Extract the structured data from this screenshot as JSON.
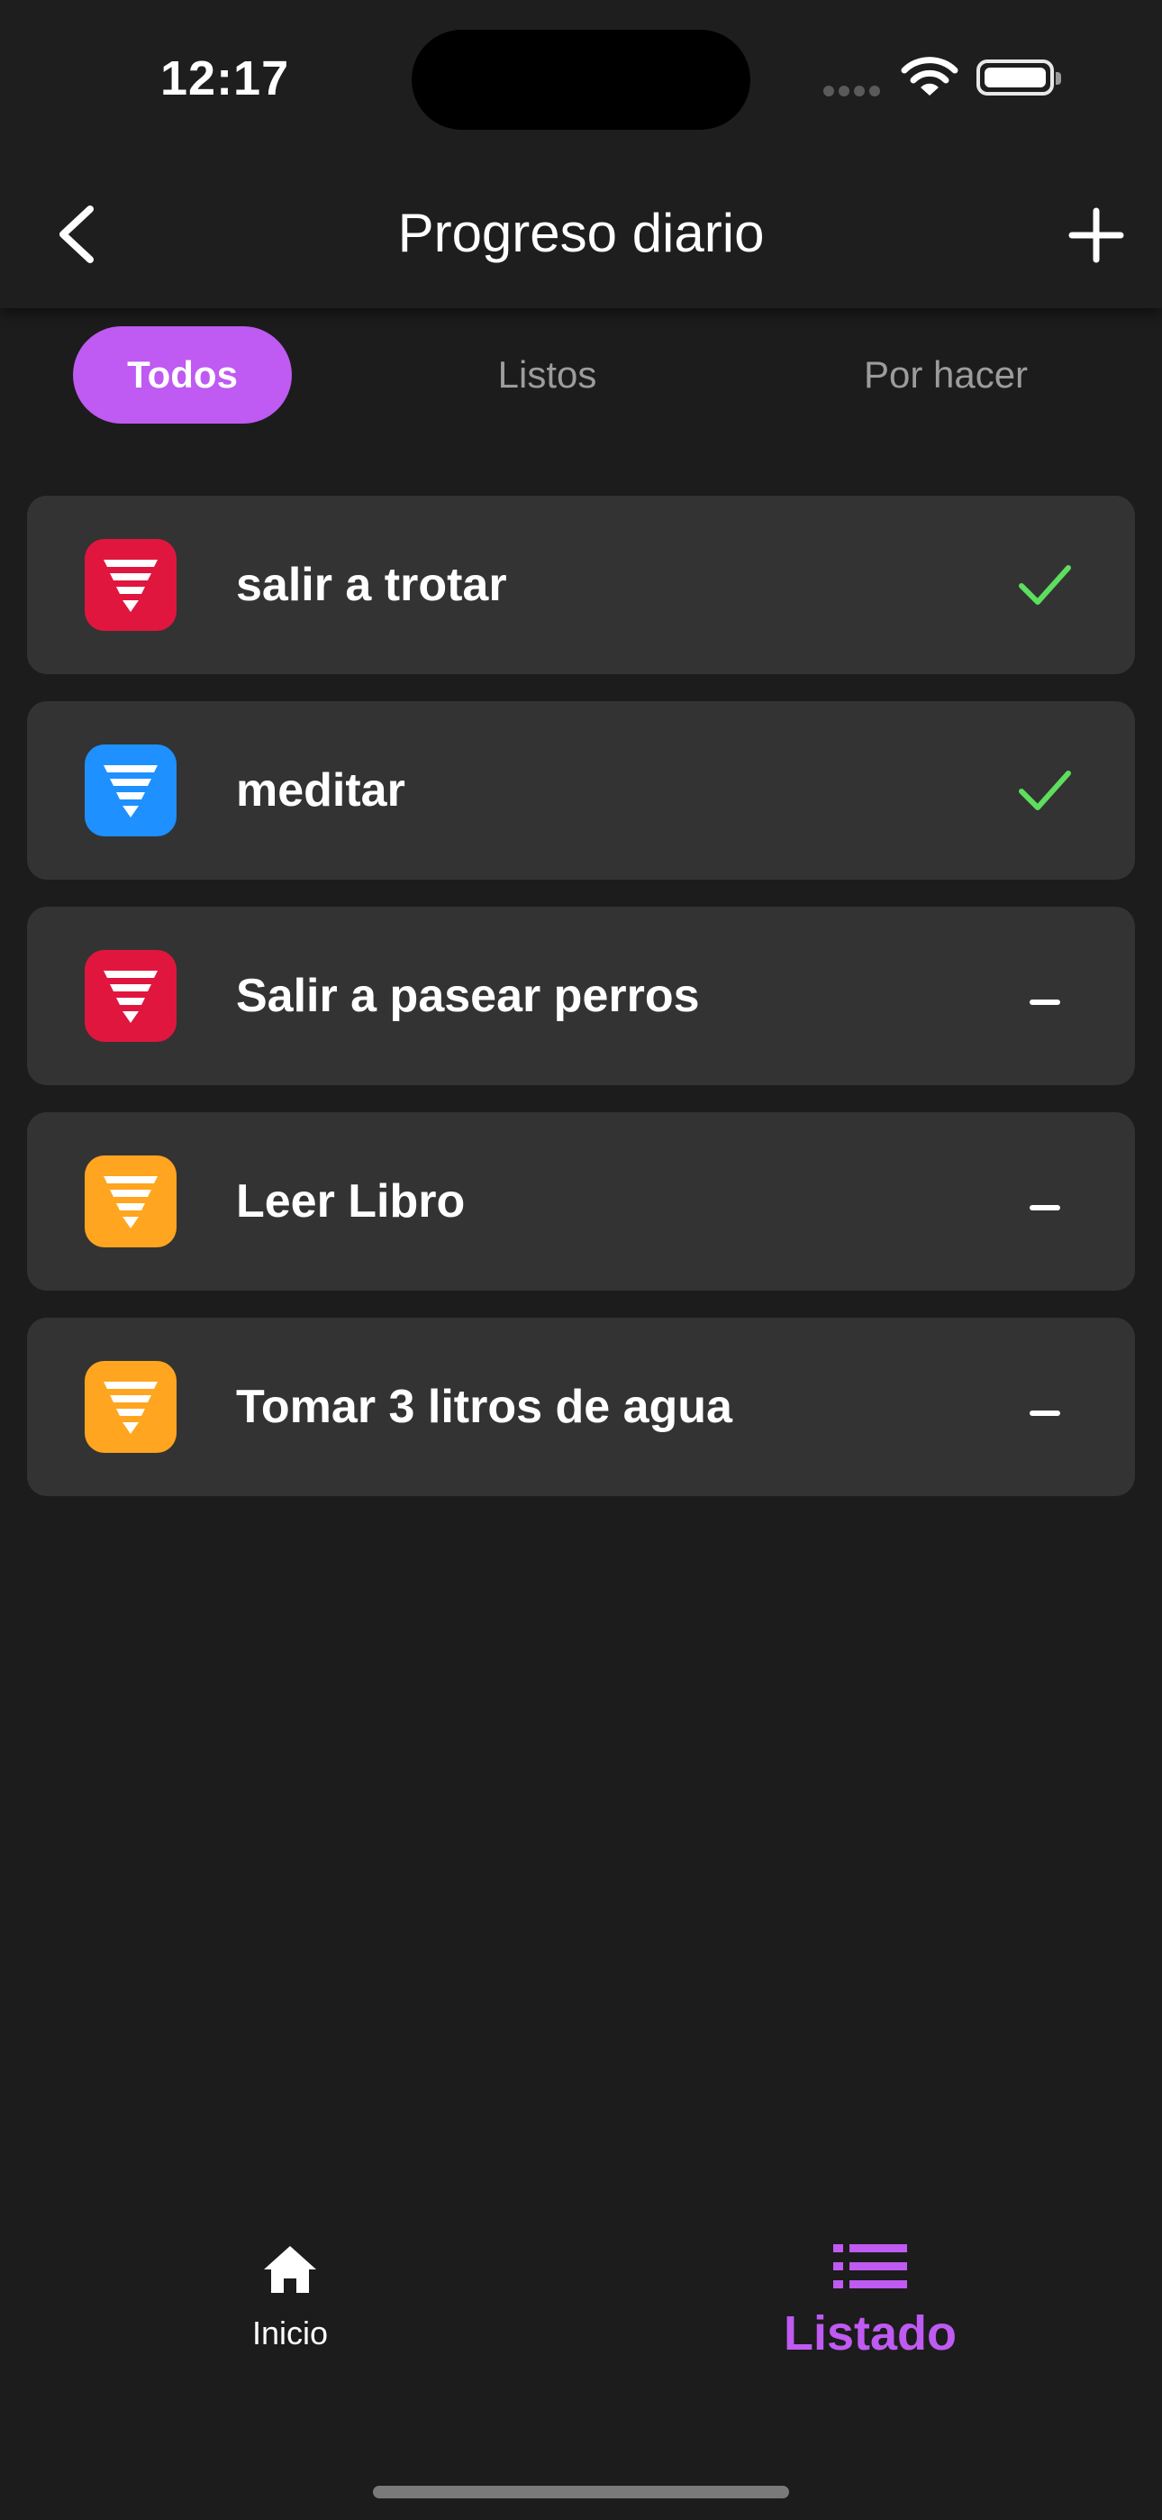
{
  "status_bar": {
    "time": "12:17"
  },
  "header": {
    "title": "Progreso diario"
  },
  "filters": {
    "all": "Todos",
    "done": "Listos",
    "todo": "Por hacer"
  },
  "habits": [
    {
      "name": "salir a trotar",
      "color": "#e0163f",
      "status": "done",
      "status_icon": "checkmark-icon"
    },
    {
      "name": "meditar",
      "color": "#1e90ff",
      "status": "done",
      "status_icon": "checkmark-icon"
    },
    {
      "name": "Salir a pasear perros",
      "color": "#e0163f",
      "status": "pending",
      "status_icon": "dash-icon"
    },
    {
      "name": "Leer Libro",
      "color": "#ffa51f",
      "status": "pending",
      "status_icon": "dash-icon"
    },
    {
      "name": "Tomar 3 litros de agua",
      "color": "#ffa51f",
      "status": "pending",
      "status_icon": "dash-icon"
    }
  ],
  "nav": {
    "home": {
      "label": "Inicio",
      "icon": "home-icon"
    },
    "list": {
      "label": "Listado",
      "icon": "list-icon"
    }
  },
  "colors": {
    "accent": "#bf5af2",
    "done_check": "#5ede5e",
    "background": "#1c1c1c",
    "card": "#333333"
  }
}
